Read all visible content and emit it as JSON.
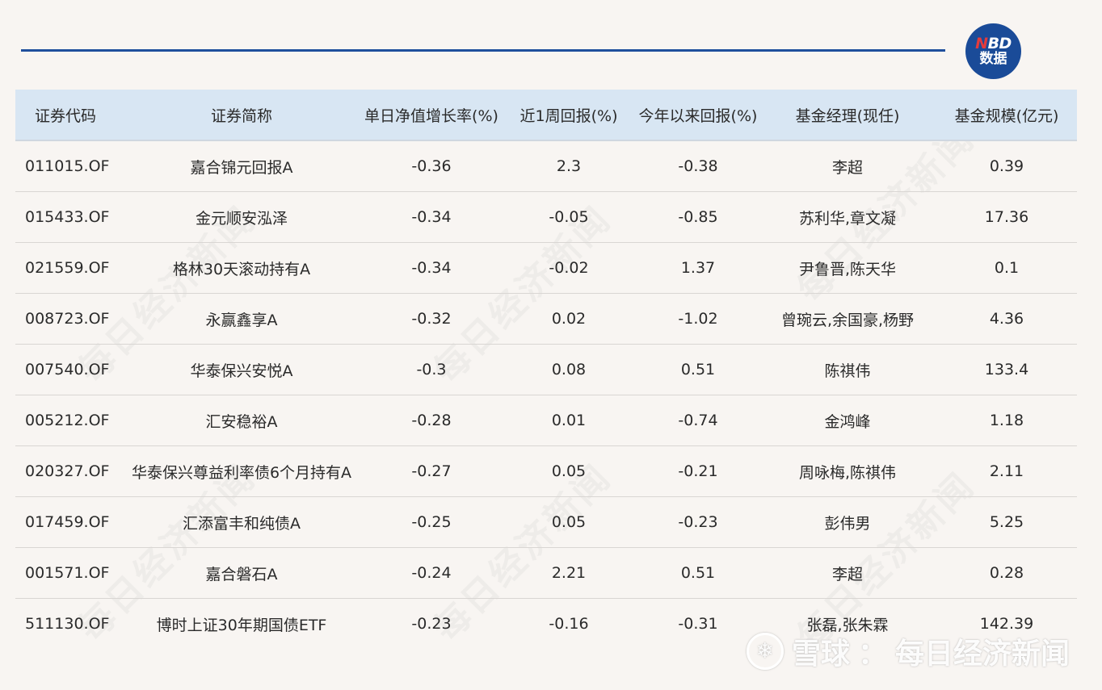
{
  "logo": {
    "top": "NBD",
    "top_n": "N",
    "top_rest": "BD",
    "bottom": "数据"
  },
  "watermark_text": "每日经济新闻",
  "bottom_watermark": {
    "brand": "雪球",
    "separator": "：",
    "source": "每日经济新闻",
    "icon": "snowball-icon"
  },
  "table": {
    "headers": [
      "证券代码",
      "证券简称",
      "单日净值增长率(%)",
      "近1周回报(%)",
      "今年以来回报(%)",
      "基金经理(现任)",
      "基金规模(亿元)"
    ],
    "rows": [
      [
        "011015.OF",
        "嘉合锦元回报A",
        "-0.36",
        "2.3",
        "-0.38",
        "李超",
        "0.39"
      ],
      [
        "015433.OF",
        "金元顺安泓泽",
        "-0.34",
        "-0.05",
        "-0.85",
        "苏利华,章文凝",
        "17.36"
      ],
      [
        "021559.OF",
        "格林30天滚动持有A",
        "-0.34",
        "-0.02",
        "1.37",
        "尹鲁晋,陈天华",
        "0.1"
      ],
      [
        "008723.OF",
        "永赢鑫享A",
        "-0.32",
        "0.02",
        "-1.02",
        "曾琬云,余国豪,杨野",
        "4.36"
      ],
      [
        "007540.OF",
        "华泰保兴安悦A",
        "-0.3",
        "0.08",
        "0.51",
        "陈祺伟",
        "133.4"
      ],
      [
        "005212.OF",
        "汇安稳裕A",
        "-0.28",
        "0.01",
        "-0.74",
        "金鸿峰",
        "1.18"
      ],
      [
        "020327.OF",
        "华泰保兴尊益利率债6个月持有A",
        "-0.27",
        "0.05",
        "-0.21",
        "周咏梅,陈祺伟",
        "2.11"
      ],
      [
        "017459.OF",
        "汇添富丰和纯债A",
        "-0.25",
        "0.05",
        "-0.23",
        "彭伟男",
        "5.25"
      ],
      [
        "001571.OF",
        "嘉合磐石A",
        "-0.24",
        "2.21",
        "0.51",
        "李超",
        "0.28"
      ],
      [
        "511130.OF",
        "博时上证30年期国债ETF",
        "-0.23",
        "-0.16",
        "-0.31",
        "张磊,张朱霖",
        "142.39"
      ]
    ]
  }
}
